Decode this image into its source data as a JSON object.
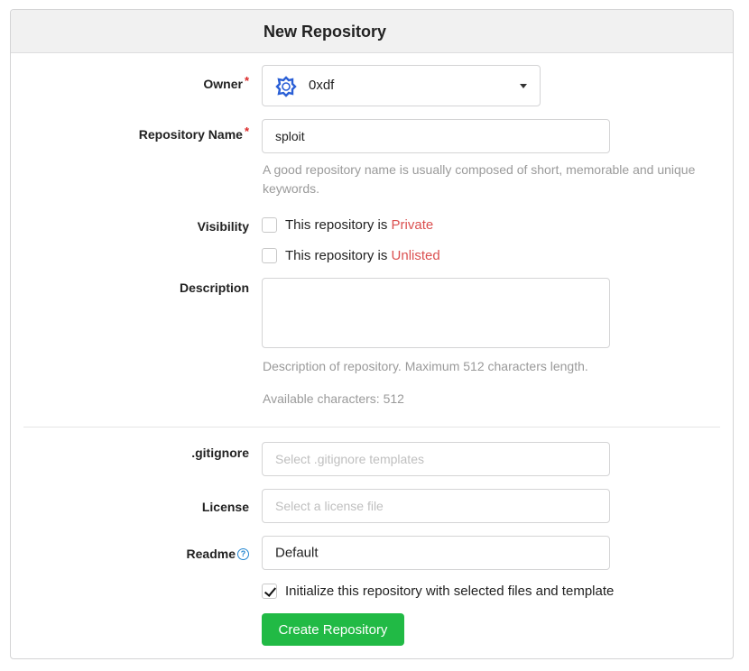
{
  "header": {
    "title": "New Repository"
  },
  "owner": {
    "label": "Owner",
    "required_mark": "*",
    "value": "0xdf"
  },
  "repo_name": {
    "label": "Repository Name",
    "required_mark": "*",
    "value": "sploit",
    "help": "A good repository name is usually composed of short, memorable and unique keywords."
  },
  "visibility": {
    "label": "Visibility",
    "private_prefix": "This repository is ",
    "private_word": "Private",
    "private_checked": false,
    "unlisted_prefix": "This repository is ",
    "unlisted_word": "Unlisted",
    "unlisted_checked": false
  },
  "description": {
    "label": "Description",
    "value": "",
    "help": "Description of repository. Maximum 512 characters length.",
    "available": "Available characters: 512"
  },
  "gitignore": {
    "label": ".gitignore",
    "placeholder": "Select .gitignore templates"
  },
  "license": {
    "label": "License",
    "placeholder": "Select a license file"
  },
  "readme": {
    "label": "Readme",
    "value": "Default",
    "help_icon": "question-circle-icon"
  },
  "init": {
    "label": "Initialize this repository with selected files and template",
    "checked": true
  },
  "submit": {
    "label": "Create Repository"
  },
  "colors": {
    "accent_green": "#21ba45",
    "required_red": "#db2828",
    "highlight_red": "#db5050",
    "owner_avatar_blue": "#2a5fd6"
  }
}
